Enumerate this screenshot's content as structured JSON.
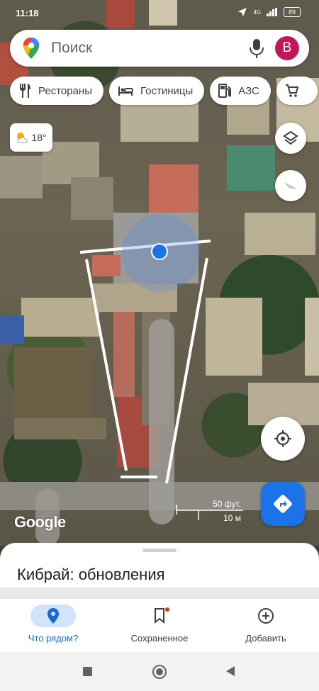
{
  "status_bar": {
    "time": "11:18",
    "battery": "89",
    "signal": "4G"
  },
  "search": {
    "placeholder": "Поиск",
    "avatar_letter": "B"
  },
  "chips": [
    {
      "label": "Рестораны",
      "icon": "restaurant-icon"
    },
    {
      "label": "Гостиницы",
      "icon": "hotel-icon"
    },
    {
      "label": "АЗС",
      "icon": "gas-station-icon"
    },
    {
      "label": "",
      "icon": "shopping-cart-icon"
    }
  ],
  "weather": {
    "temp": "18°",
    "icon": "partly-sunny-icon"
  },
  "map": {
    "attribution": "Google",
    "scale_imperial": "50 фут.",
    "scale_metric": "10 м"
  },
  "sheet": {
    "title": "Кибрай: обновления"
  },
  "nav": {
    "tabs": [
      {
        "label": "Что рядом?",
        "icon": "explore-pin-icon",
        "active": true
      },
      {
        "label": "Сохраненное",
        "icon": "bookmark-icon",
        "active": false
      },
      {
        "label": "Добавить",
        "icon": "add-circle-icon",
        "active": false
      }
    ]
  },
  "colors": {
    "accent": "#1a73e8",
    "avatar": "#c2185b",
    "active_tab_bg": "#d2e3fc"
  }
}
